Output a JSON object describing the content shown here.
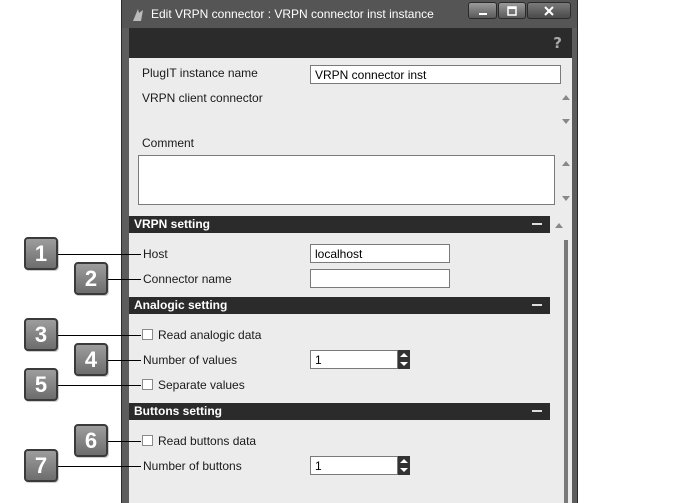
{
  "window": {
    "title": "Edit VRPN connector : VRPN connector inst instance",
    "help_glyph": "?"
  },
  "general": {
    "plugit_instance_label": "PlugIT instance name",
    "plugit_instance_value": "VRPN connector inst",
    "description": "VRPN client connector",
    "comment_label": "Comment",
    "comment_value": ""
  },
  "vrpn_setting": {
    "title": "VRPN setting",
    "host_label": "Host",
    "host_value": "localhost",
    "connector_name_label": "Connector name",
    "connector_name_value": ""
  },
  "analogic_setting": {
    "title": "Analogic setting",
    "read_analogic_label": "Read analogic data",
    "read_analogic_checked": false,
    "number_of_values_label": "Number of values",
    "number_of_values": "1",
    "separate_values_label": "Separate values",
    "separate_values_checked": false
  },
  "buttons_setting": {
    "title": "Buttons setting",
    "read_buttons_label": "Read buttons data",
    "read_buttons_checked": false,
    "number_of_buttons_label": "Number of buttons",
    "number_of_buttons": "1"
  },
  "callouts": [
    "1",
    "2",
    "3",
    "4",
    "5",
    "6",
    "7"
  ],
  "icons": {
    "app": "app-icon",
    "minimize": "minimize-icon",
    "maximize": "maximize-icon",
    "close": "close-icon",
    "help": "help-icon",
    "collapse": "collapse-icon"
  }
}
